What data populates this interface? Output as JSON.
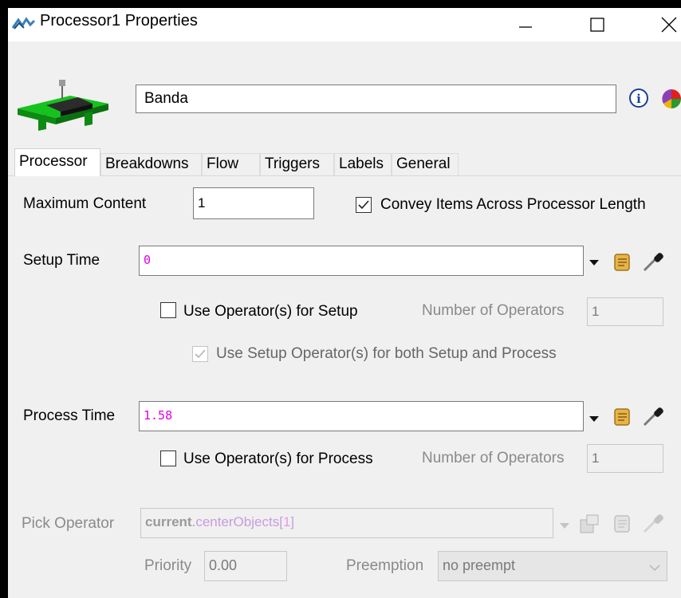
{
  "window": {
    "title": "Processor1  Properties",
    "controls": {
      "minimize": "—",
      "maximize": "☐",
      "close": "✕"
    }
  },
  "header": {
    "name_value": "Banda"
  },
  "tabs": [
    {
      "label": "Processor",
      "active": true
    },
    {
      "label": "Breakdowns",
      "active": false
    },
    {
      "label": "Flow",
      "active": false
    },
    {
      "label": "Triggers",
      "active": false
    },
    {
      "label": "Labels",
      "active": false
    },
    {
      "label": "General",
      "active": false
    }
  ],
  "processor": {
    "max_content_label": "Maximum Content",
    "max_content_value": "1",
    "convey_label": "Convey Items Across Processor Length",
    "convey_checked": true,
    "setup_time_label": "Setup Time",
    "setup_time_value": "0",
    "use_op_setup_label": "Use Operator(s) for Setup",
    "use_op_setup_checked": false,
    "num_ops_label_1": "Number of Operators",
    "num_ops_value_1": "1",
    "use_setup_both_label": "Use Setup Operator(s) for both Setup and Process",
    "use_setup_both_checked": true,
    "process_time_label": "Process Time",
    "process_time_value": "1.58",
    "use_op_process_label": "Use Operator(s) for Process",
    "use_op_process_checked": false,
    "num_ops_label_2": "Number of Operators",
    "num_ops_value_2": "1",
    "pick_operator_label": "Pick Operator",
    "pick_operator_code": {
      "keyword": "current",
      "dot": ".",
      "member": "centerObjects",
      "open": "[",
      "index": "1",
      "close": "]"
    },
    "priority_label": "Priority",
    "priority_value": "0.00",
    "preemption_label": "Preemption",
    "preemption_value": "no preempt"
  },
  "colors": {
    "code_magenta": "#e000e0",
    "keyword_disabled": "#9a9a9a",
    "member_disabled": "#c99be0"
  }
}
